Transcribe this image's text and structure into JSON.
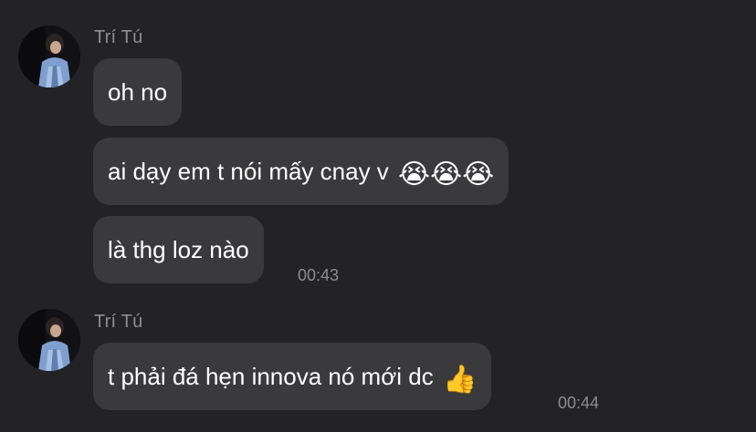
{
  "groups": [
    {
      "sender": "Trí Tú",
      "messages": [
        {
          "text": "oh no",
          "emoji": ""
        },
        {
          "text": "ai dạy em t nói mấy cnay v",
          "emoji": "😭😭😭"
        },
        {
          "text": "là thg loz nào",
          "emoji": ""
        }
      ],
      "time": "00:43"
    },
    {
      "sender": "Trí Tú",
      "messages": [
        {
          "text": "t phải đá hẹn innova nó mới dc",
          "emoji": "👍"
        }
      ],
      "time": "00:44"
    }
  ],
  "colors": {
    "background": "#232325",
    "bubble": "#3a3a3d",
    "meta_text": "#8d8d92",
    "message_text": "#ffffff"
  }
}
